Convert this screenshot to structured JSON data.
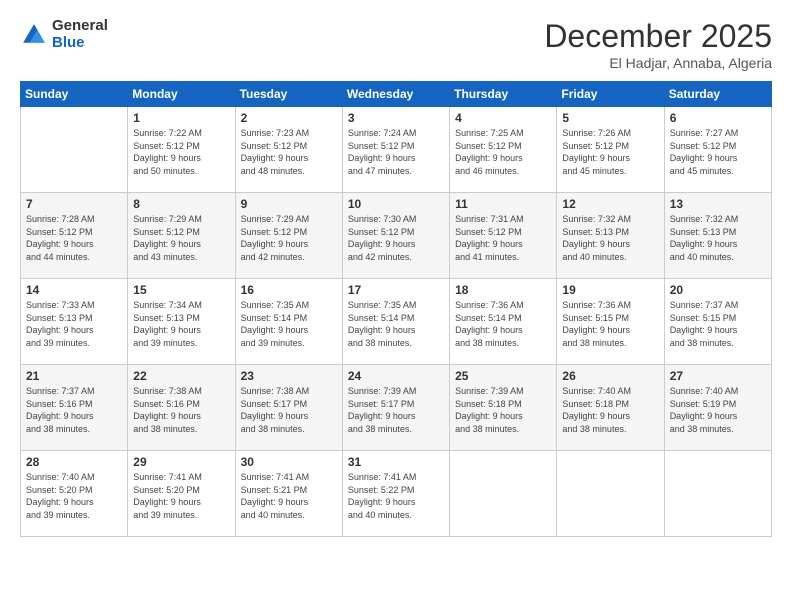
{
  "logo": {
    "general": "General",
    "blue": "Blue"
  },
  "header": {
    "month": "December 2025",
    "location": "El Hadjar, Annaba, Algeria"
  },
  "weekdays": [
    "Sunday",
    "Monday",
    "Tuesday",
    "Wednesday",
    "Thursday",
    "Friday",
    "Saturday"
  ],
  "weeks": [
    [
      {
        "day": "",
        "info": ""
      },
      {
        "day": "1",
        "info": "Sunrise: 7:22 AM\nSunset: 5:12 PM\nDaylight: 9 hours\nand 50 minutes."
      },
      {
        "day": "2",
        "info": "Sunrise: 7:23 AM\nSunset: 5:12 PM\nDaylight: 9 hours\nand 48 minutes."
      },
      {
        "day": "3",
        "info": "Sunrise: 7:24 AM\nSunset: 5:12 PM\nDaylight: 9 hours\nand 47 minutes."
      },
      {
        "day": "4",
        "info": "Sunrise: 7:25 AM\nSunset: 5:12 PM\nDaylight: 9 hours\nand 46 minutes."
      },
      {
        "day": "5",
        "info": "Sunrise: 7:26 AM\nSunset: 5:12 PM\nDaylight: 9 hours\nand 45 minutes."
      },
      {
        "day": "6",
        "info": "Sunrise: 7:27 AM\nSunset: 5:12 PM\nDaylight: 9 hours\nand 45 minutes."
      }
    ],
    [
      {
        "day": "7",
        "info": "Sunrise: 7:28 AM\nSunset: 5:12 PM\nDaylight: 9 hours\nand 44 minutes."
      },
      {
        "day": "8",
        "info": "Sunrise: 7:29 AM\nSunset: 5:12 PM\nDaylight: 9 hours\nand 43 minutes."
      },
      {
        "day": "9",
        "info": "Sunrise: 7:29 AM\nSunset: 5:12 PM\nDaylight: 9 hours\nand 42 minutes."
      },
      {
        "day": "10",
        "info": "Sunrise: 7:30 AM\nSunset: 5:12 PM\nDaylight: 9 hours\nand 42 minutes."
      },
      {
        "day": "11",
        "info": "Sunrise: 7:31 AM\nSunset: 5:12 PM\nDaylight: 9 hours\nand 41 minutes."
      },
      {
        "day": "12",
        "info": "Sunrise: 7:32 AM\nSunset: 5:13 PM\nDaylight: 9 hours\nand 40 minutes."
      },
      {
        "day": "13",
        "info": "Sunrise: 7:32 AM\nSunset: 5:13 PM\nDaylight: 9 hours\nand 40 minutes."
      }
    ],
    [
      {
        "day": "14",
        "info": "Sunrise: 7:33 AM\nSunset: 5:13 PM\nDaylight: 9 hours\nand 39 minutes."
      },
      {
        "day": "15",
        "info": "Sunrise: 7:34 AM\nSunset: 5:13 PM\nDaylight: 9 hours\nand 39 minutes."
      },
      {
        "day": "16",
        "info": "Sunrise: 7:35 AM\nSunset: 5:14 PM\nDaylight: 9 hours\nand 39 minutes."
      },
      {
        "day": "17",
        "info": "Sunrise: 7:35 AM\nSunset: 5:14 PM\nDaylight: 9 hours\nand 38 minutes."
      },
      {
        "day": "18",
        "info": "Sunrise: 7:36 AM\nSunset: 5:14 PM\nDaylight: 9 hours\nand 38 minutes."
      },
      {
        "day": "19",
        "info": "Sunrise: 7:36 AM\nSunset: 5:15 PM\nDaylight: 9 hours\nand 38 minutes."
      },
      {
        "day": "20",
        "info": "Sunrise: 7:37 AM\nSunset: 5:15 PM\nDaylight: 9 hours\nand 38 minutes."
      }
    ],
    [
      {
        "day": "21",
        "info": "Sunrise: 7:37 AM\nSunset: 5:16 PM\nDaylight: 9 hours\nand 38 minutes."
      },
      {
        "day": "22",
        "info": "Sunrise: 7:38 AM\nSunset: 5:16 PM\nDaylight: 9 hours\nand 38 minutes."
      },
      {
        "day": "23",
        "info": "Sunrise: 7:38 AM\nSunset: 5:17 PM\nDaylight: 9 hours\nand 38 minutes."
      },
      {
        "day": "24",
        "info": "Sunrise: 7:39 AM\nSunset: 5:17 PM\nDaylight: 9 hours\nand 38 minutes."
      },
      {
        "day": "25",
        "info": "Sunrise: 7:39 AM\nSunset: 5:18 PM\nDaylight: 9 hours\nand 38 minutes."
      },
      {
        "day": "26",
        "info": "Sunrise: 7:40 AM\nSunset: 5:18 PM\nDaylight: 9 hours\nand 38 minutes."
      },
      {
        "day": "27",
        "info": "Sunrise: 7:40 AM\nSunset: 5:19 PM\nDaylight: 9 hours\nand 38 minutes."
      }
    ],
    [
      {
        "day": "28",
        "info": "Sunrise: 7:40 AM\nSunset: 5:20 PM\nDaylight: 9 hours\nand 39 minutes."
      },
      {
        "day": "29",
        "info": "Sunrise: 7:41 AM\nSunset: 5:20 PM\nDaylight: 9 hours\nand 39 minutes."
      },
      {
        "day": "30",
        "info": "Sunrise: 7:41 AM\nSunset: 5:21 PM\nDaylight: 9 hours\nand 40 minutes."
      },
      {
        "day": "31",
        "info": "Sunrise: 7:41 AM\nSunset: 5:22 PM\nDaylight: 9 hours\nand 40 minutes."
      },
      {
        "day": "",
        "info": ""
      },
      {
        "day": "",
        "info": ""
      },
      {
        "day": "",
        "info": ""
      }
    ]
  ]
}
